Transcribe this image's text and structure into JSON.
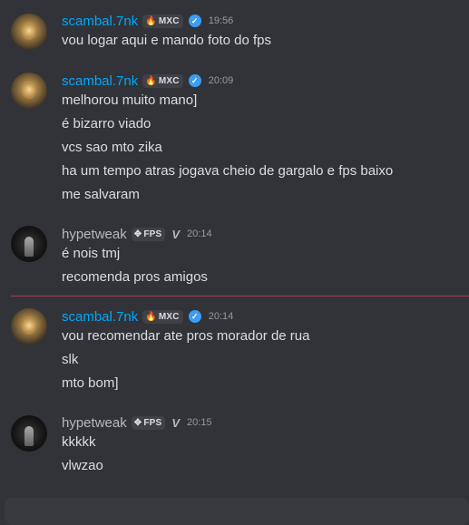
{
  "messages": [
    {
      "author": "scambal.7nk",
      "author_color": "#00a8fc",
      "tag": "MXC",
      "tag_icon": "fire-icon",
      "verified": true,
      "time": "19:56",
      "lines": [
        "vou logar aqui e mando foto do fps"
      ]
    },
    {
      "author": "scambal.7nk",
      "author_color": "#00a8fc",
      "tag": "MXC",
      "tag_icon": "fire-icon",
      "verified": true,
      "time": "20:09",
      "lines": [
        "melhorou muito mano]",
        "é bizarro viado",
        "vcs sao mto zika",
        "ha um tempo atras jogava cheio de gargalo e fps baixo",
        "me salvaram"
      ]
    },
    {
      "author": "hypetweak",
      "author_color": "#b5bac1",
      "tag": "FPS",
      "tag_icon": "crosshair-icon",
      "badge": "V",
      "time": "20:14",
      "lines": [
        "é nois tmj",
        "recomenda pros amigos"
      ]
    },
    {
      "author": "scambal.7nk",
      "author_color": "#00a8fc",
      "tag": "MXC",
      "tag_icon": "fire-icon",
      "verified": true,
      "time": "20:14",
      "lines": [
        "vou recomendar ate pros morador de rua",
        "slk",
        "mto bom]"
      ]
    },
    {
      "author": "hypetweak",
      "author_color": "#b5bac1",
      "tag": "FPS",
      "tag_icon": "crosshair-icon",
      "badge": "V",
      "time": "20:15",
      "lines": [
        "kkkkk",
        "vlwzao"
      ]
    }
  ],
  "colors": {
    "background": "#313338",
    "text": "#dbdee1",
    "timestamp": "#949ba4",
    "new_messages_divider": "#d5454b"
  }
}
